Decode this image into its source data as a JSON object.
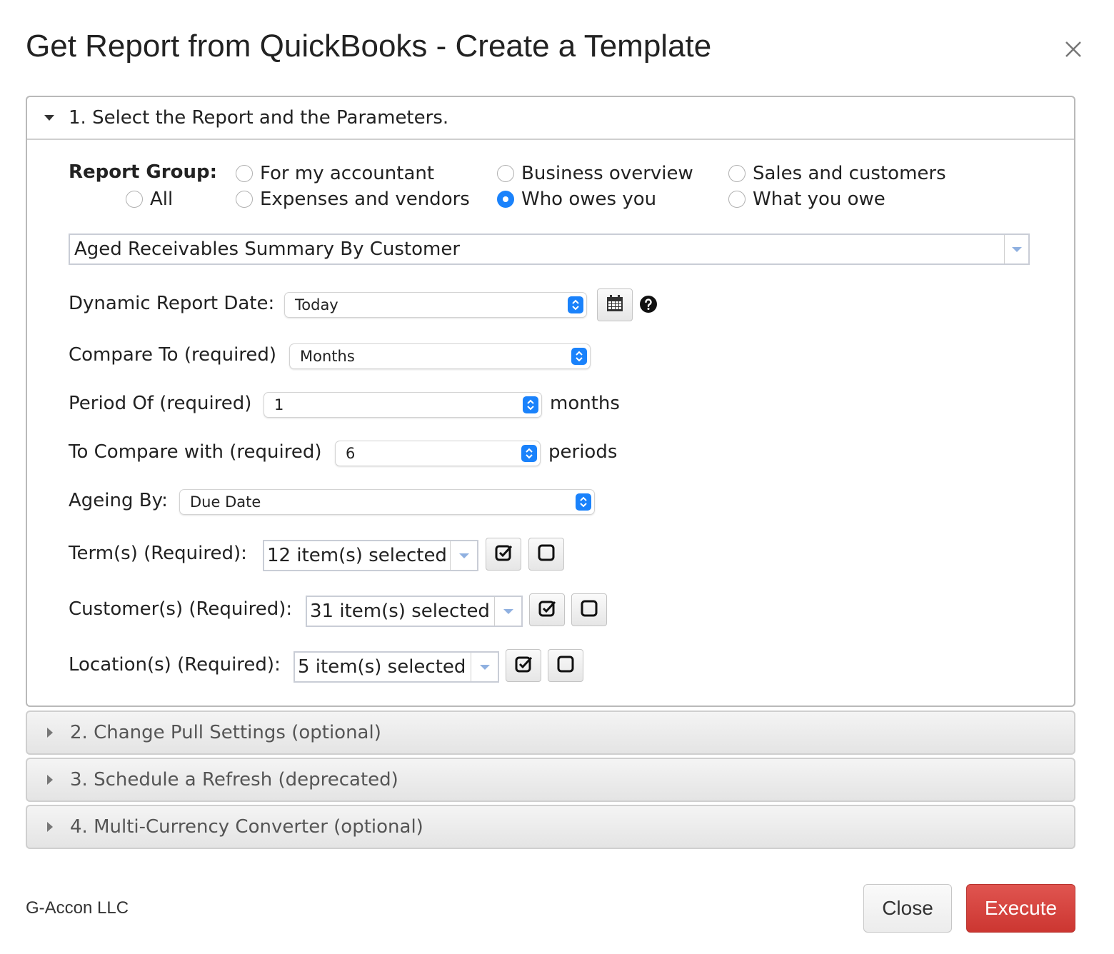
{
  "dialog": {
    "title": "Get Report from QuickBooks - Create a Template"
  },
  "sections": {
    "s1": {
      "title": "1. Select the Report and the Parameters."
    },
    "s2": {
      "title": "2. Change Pull Settings (optional)"
    },
    "s3": {
      "title": "3. Schedule a Refresh (deprecated)"
    },
    "s4": {
      "title": "4. Multi-Currency Converter (optional)"
    }
  },
  "report_group": {
    "label": "Report Group:",
    "options": [
      {
        "label": "All",
        "checked": false
      },
      {
        "label": "For my accountant",
        "checked": false
      },
      {
        "label": "Expenses and vendors",
        "checked": false
      },
      {
        "label": "Business overview",
        "checked": false
      },
      {
        "label": "Who owes you",
        "checked": true
      },
      {
        "label": "Sales and customers",
        "checked": false
      },
      {
        "label": "What you owe",
        "checked": false
      }
    ]
  },
  "report_select": {
    "value": "Aged Receivables Summary By Customer"
  },
  "params": {
    "dynamic_date": {
      "label": "Dynamic Report Date:",
      "value": "Today"
    },
    "compare_to": {
      "label": "Compare To (required)",
      "value": "Months"
    },
    "period_of": {
      "label": "Period Of (required)",
      "value": "1",
      "suffix": "months"
    },
    "compare_with": {
      "label": "To Compare with (required)",
      "value": "6",
      "suffix": "periods"
    },
    "ageing_by": {
      "label": "Ageing By:",
      "value": "Due Date"
    },
    "terms": {
      "label": "Term(s) (Required):",
      "value": "12 item(s) selected"
    },
    "customers": {
      "label": "Customer(s) (Required):",
      "value": "31 item(s) selected"
    },
    "locations": {
      "label": "Location(s) (Required):",
      "value": "5 item(s) selected"
    }
  },
  "footer": {
    "brand": "G-Accon LLC",
    "close_label": "Close",
    "execute_label": "Execute"
  },
  "colors": {
    "accent": "#1a82fb",
    "execute": "#cc3631",
    "border": "#b9b9b9"
  }
}
